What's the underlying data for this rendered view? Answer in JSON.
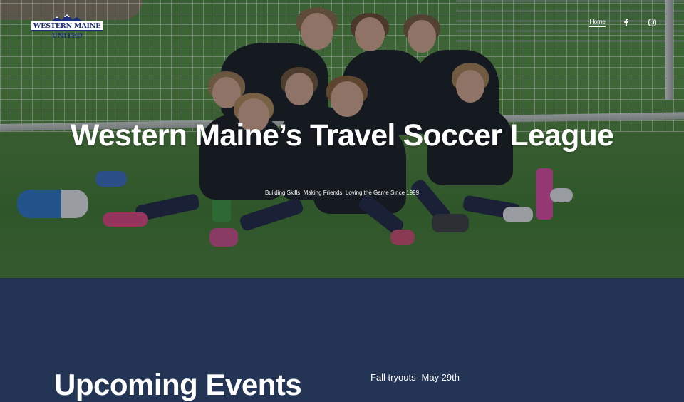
{
  "brand": {
    "logo_text": "WESTERN MAINE UNITED",
    "logo_color": "#1d2f7a"
  },
  "nav": {
    "items": [
      {
        "label": "Home",
        "active": true
      }
    ],
    "social": [
      {
        "icon": "facebook-icon"
      },
      {
        "icon": "instagram-icon"
      }
    ]
  },
  "hero": {
    "title": "Western Maine’s Travel Soccer League",
    "subtitle": "Building Skills, Making Friends, Loving the Game Since 1999"
  },
  "events": {
    "heading": "Upcoming Events",
    "items": [
      {
        "text": "Fall tryouts- May 29th"
      }
    ]
  },
  "colors": {
    "section_bg": "#243455",
    "text": "#ffffff"
  }
}
